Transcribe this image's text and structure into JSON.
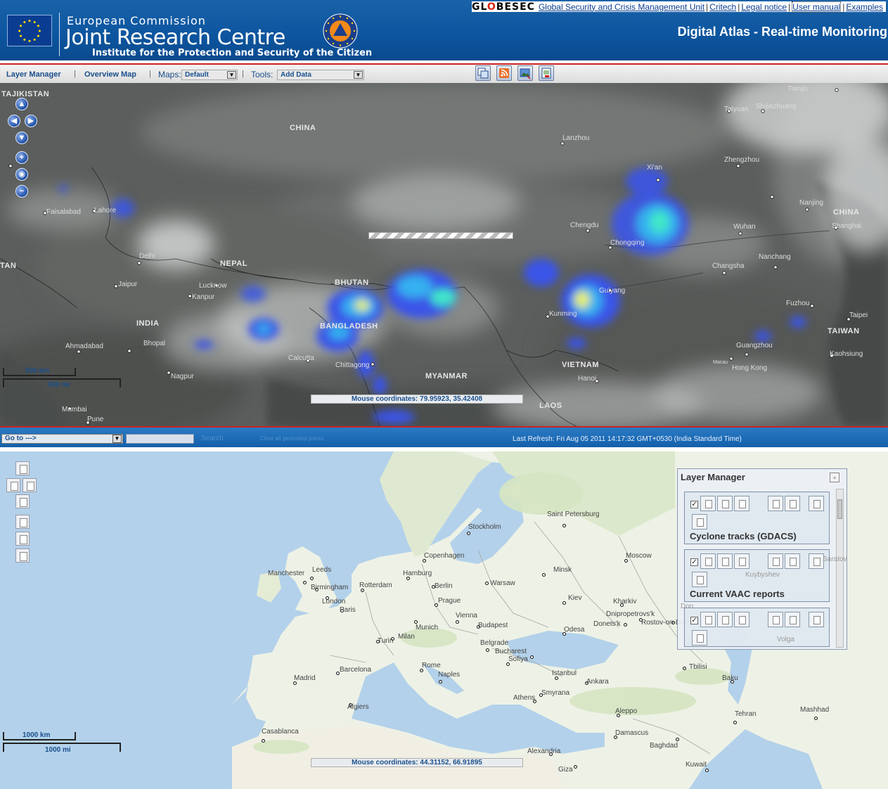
{
  "header": {
    "org_line1": "European Commission",
    "org_line2": "Joint Research Centre",
    "org_line3": "Institute for the Protection and Security of the Citizen",
    "app_title": "Digital Atlas - Real-time Monitoring",
    "brand": "GLOBESEC",
    "links": [
      "Global Security and Crisis Management Unit",
      "Critech",
      "Legal notice",
      "User manual",
      "Examples"
    ]
  },
  "toolbar": {
    "layer_manager": "Layer Manager",
    "overview_map": "Overview Map",
    "maps_label": "Maps:",
    "maps_value": "Default",
    "tools_label": "Tools:",
    "tools_value": "Add Data"
  },
  "top_map": {
    "countries": [
      "TAJIKISTAN",
      "CHINA",
      "NEPAL",
      "BHUTAN",
      "INDIA",
      "BANGLADESH",
      "MYANMAR",
      "VIETNAM",
      "LAOS",
      "TAIWAN",
      "CHINA",
      "TAN"
    ],
    "cities": [
      "Taiyuan",
      "Shijiazhuang",
      "Lanzhou",
      "Zhengzhou",
      "Xi'an",
      "Nanjing",
      "Shanghai",
      "Chengdu",
      "Wuhan",
      "Nanchang",
      "Changsha",
      "Chongqing",
      "Kunming",
      "Guiyang",
      "Fuzhou",
      "Taipei",
      "Kaohsiung",
      "Guangzhou",
      "Hong Kong",
      "Macau",
      "Hanoi",
      "Faisalabad",
      "Delhi",
      "Jaipur",
      "Lucknow",
      "Kanpur",
      "Ahmadabad",
      "Bhopal",
      "Calcutta",
      "Chittagong",
      "Nagpur",
      "Pune",
      "Mumbai",
      "Tianjin",
      "Lahore"
    ],
    "scale_km": "500 km",
    "scale_mi": "500 mi",
    "mouse_coords": "Mouse coordinates: 79.95923, 35.42408"
  },
  "statusbar": {
    "goto": "Go to --->",
    "search": "Search",
    "clear": "Clear all geocoded points",
    "last_refresh": "Last Refresh: Fri Aug 05 2011 14:17:32 GMT+0530 (India Standard Time)"
  },
  "bottom_map": {
    "cities": [
      "Stockholm",
      "Saint Petersburg",
      "Copenhagen",
      "Moscow",
      "Leeds",
      "Manchester",
      "Birmingham",
      "London",
      "Rotterdam",
      "Hamburg",
      "Berlin",
      "Warsaw",
      "Minsk",
      "Paris",
      "Prague",
      "Kiev",
      "Kharkiv",
      "Munich",
      "Vienna",
      "Budapest",
      "Dnipropetrovs'k",
      "Donets'k",
      "Rostov-on-Don",
      "Odesa",
      "Turin",
      "Milan",
      "Belgrade",
      "Bucharest",
      "Sofiya",
      "Barcelona",
      "Madrid",
      "Rome",
      "Naples",
      "Istanbul",
      "Ankara",
      "Tbilisi",
      "Baku",
      "Athens",
      "Smyrana",
      "Algiers",
      "Casablanca",
      "Aleppo",
      "Damascus",
      "Baghdad",
      "Tehran",
      "Mashhad",
      "Alexandria",
      "Giza",
      "Kuwait",
      "Kuybyshev",
      "Don",
      "Saratov",
      "Volga"
    ],
    "scale_km": "1000 km",
    "scale_mi": "1000 mi",
    "mouse_coords": "Mouse coordinates: 44.31152, 66.91895"
  },
  "layer_manager": {
    "title": "Layer Manager",
    "items": [
      {
        "name": "Cyclone tracks (GDACS)",
        "checked": true
      },
      {
        "name": "Current VAAC reports",
        "checked": true
      },
      {
        "name": "",
        "checked": true
      }
    ]
  },
  "colors": {
    "header_blue": "#0d56a0",
    "accent_red": "#cc2222",
    "link_blue": "#0a3d91",
    "rain_blue": "#3a64e8",
    "rain_cyan": "#35d6e0",
    "rain_yellow": "#e8f060"
  }
}
